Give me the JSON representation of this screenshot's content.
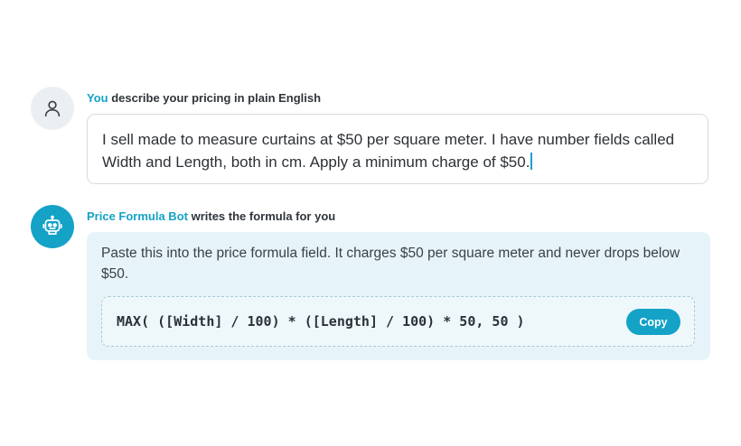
{
  "conversation": {
    "user_message": {
      "sender": "You",
      "caption": " describe your pricing in plain English",
      "avatar_icon": "user-icon",
      "text": "I sell made to measure curtains at $50 per square meter. I have number fields called Width and Length, both in cm. Apply a minimum charge of $50."
    },
    "bot_message": {
      "sender": "Price Formula Bot",
      "caption": " writes the formula for you",
      "avatar_icon": "robot-icon",
      "text": "Paste this into the price formula field. It charges $50 per square meter and never drops below $50.",
      "formula": "MAX( ([Width] / 100) * ([Length] / 100) * 50, 50 )",
      "copy_label": "Copy"
    }
  },
  "colors": {
    "accent": "#14a2c7",
    "bot_bubble": "#e6f4f9",
    "user_avatar_bg": "#eceff2"
  }
}
